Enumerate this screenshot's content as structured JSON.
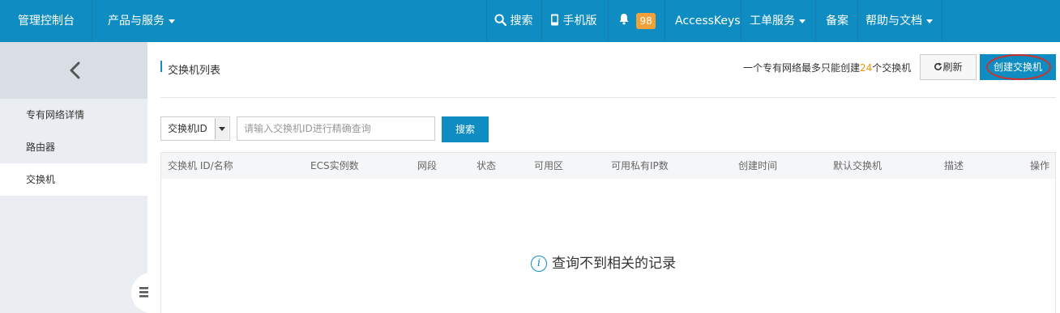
{
  "topbar": {
    "console": "管理控制台",
    "products": "产品与服务",
    "search": "搜索",
    "mobile": "手机版",
    "notifications_count": "98",
    "accesskeys": "AccessKeys",
    "tickets": "工单服务",
    "beian": "备案",
    "help": "帮助与文档"
  },
  "sidebar": {
    "items": [
      {
        "label": "专有网络详情"
      },
      {
        "label": "路由器"
      },
      {
        "label": "交换机"
      }
    ]
  },
  "main": {
    "title": "交换机列表",
    "limit_prefix": "一个专有网络最多只能创建",
    "limit_count": "24",
    "limit_suffix": "个交换机",
    "refresh": "刷新",
    "create": "创建交换机",
    "filter_select": "交换机ID",
    "search_placeholder": "请输入交换机ID进行精确查询",
    "search_button": "搜索",
    "columns": [
      "交换机 ID/名称",
      "ECS实例数",
      "网段",
      "状态",
      "可用区",
      "可用私有IP数",
      "创建时间",
      "默认交换机",
      "描述",
      "操作"
    ],
    "empty_text": "查询不到相关的记录"
  },
  "icons": [
    "search-icon",
    "mobile-icon",
    "bell-icon",
    "back-chevron-icon",
    "refresh-icon",
    "info-icon",
    "menu-icon"
  ],
  "colors": {
    "brand": "#0f8dc3",
    "badge": "#f0a13a",
    "limit_number": "#f39800",
    "highlight_ring": "#d0302c",
    "sidebar_bg": "#eaedf1"
  }
}
